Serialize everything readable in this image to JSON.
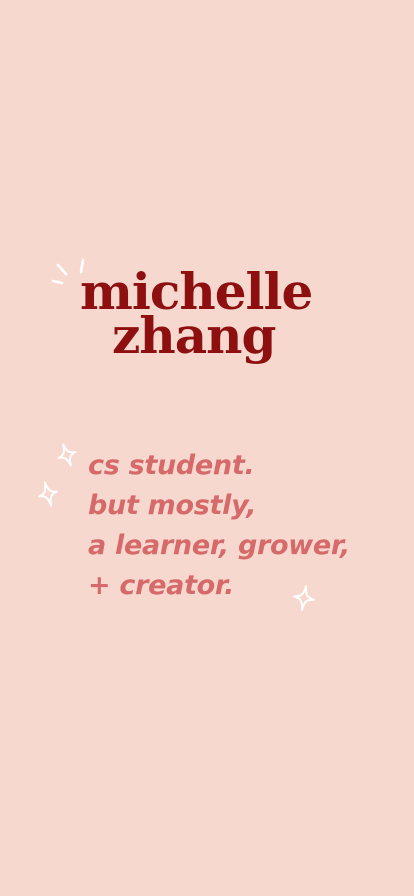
{
  "hero": {
    "name_line1": "michelle",
    "name_line2": "zhang"
  },
  "tagline": {
    "lines": [
      "cs student.",
      "but mostly,",
      "a learner, grower,",
      "+ creator."
    ]
  },
  "colors": {
    "background": "#f7d8cf",
    "name": "#8e0f0f",
    "tagline": "#d66a6a",
    "decoration": "#ffffff"
  }
}
